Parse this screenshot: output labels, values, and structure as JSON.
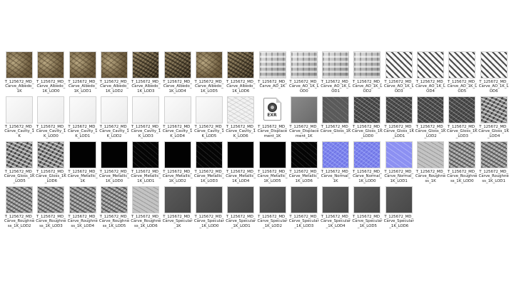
{
  "files": [
    {
      "name": "T_125672_MD_Carve_Albedo_1K",
      "style": "albedo"
    },
    {
      "name": "T_125672_MD_Carve_Albedo_1K_LOD0",
      "style": "albedo"
    },
    {
      "name": "T_125672_MD_Carve_Albedo_1K_LOD1",
      "style": "albedo"
    },
    {
      "name": "T_125672_MD_Carve_Albedo_1K_LOD2",
      "style": "albedo"
    },
    {
      "name": "T_125672_MD_Carve_Albedo_1K_LOD3",
      "style": "albedo-dark"
    },
    {
      "name": "T_125672_MD_Carve_Albedo_1K_LOD4",
      "style": "albedo-dark"
    },
    {
      "name": "T_125672_MD_Carve_Albedo_1K_LOD5",
      "style": "albedo"
    },
    {
      "name": "T_125672_MD_Carve_Albedo_1K_LOD6",
      "style": "albedo-dark"
    },
    {
      "name": "T_125672_MD_Carve_AO_1K",
      "style": "ao"
    },
    {
      "name": "T_125672_MD_Carve_AO_1K_LOD0",
      "style": "ao"
    },
    {
      "name": "T_125672_MD_Carve_AO_1K_LOD1",
      "style": "ao"
    },
    {
      "name": "T_125672_MD_Carve_AO_1K_LOD2",
      "style": "ao"
    },
    {
      "name": "T_125672_MD_Carve_AO_1K_LOD3",
      "style": "ao-strong"
    },
    {
      "name": "T_125672_MD_Carve_AO_1K_LOD4",
      "style": "ao-strong"
    },
    {
      "name": "T_125672_MD_Carve_AO_1K_LOD5",
      "style": "ao-strong"
    },
    {
      "name": "T_125672_MD_Carve_AO_1K_LOD6",
      "style": "ao-strong"
    },
    {
      "name": "T_125672_MD_Carve_Cavity_1K",
      "style": "cavity"
    },
    {
      "name": "T_125672_MD_Carve_Cavity_1K_LOD0",
      "style": "cavity"
    },
    {
      "name": "T_125672_MD_Carve_Cavity_1K_LOD1",
      "style": "cavity"
    },
    {
      "name": "T_125672_MD_Carve_Cavity_1K_LOD2",
      "style": "cavity"
    },
    {
      "name": "T_125672_MD_Carve_Cavity_1K_LOD3",
      "style": "cavity"
    },
    {
      "name": "T_125672_MD_Carve_Cavity_1K_LOD4",
      "style": "cavity"
    },
    {
      "name": "T_125672_MD_Carve_Cavity_1K_LOD5",
      "style": "cavity"
    },
    {
      "name": "T_125672_MD_Carve_Cavity_1K_LOD6",
      "style": "cavity-pattern"
    },
    {
      "name": "T_125672_MD_Carve_Displacement_1K",
      "style": "exr"
    },
    {
      "name": "T_125672_MD_Carve_Displacement_1K",
      "style": "gray-flat"
    },
    {
      "name": "T_125672_MD_Carve_Gloss_1K",
      "style": "gray-mid"
    },
    {
      "name": "T_125672_MD_Carve_Gloss_1K_LOD0",
      "style": "gloss"
    },
    {
      "name": "T_125672_MD_Carve_Gloss_1K_LOD1",
      "style": "gloss"
    },
    {
      "name": "T_125672_MD_Carve_Gloss_1K_LOD2",
      "style": "gloss"
    },
    {
      "name": "T_125672_MD_Carve_Gloss_1K_LOD3",
      "style": "gloss"
    },
    {
      "name": "T_125672_MD_Carve_Gloss_1K_LOD4",
      "style": "gloss-busy"
    },
    {
      "name": "T_125672_MD_Carve_Gloss_1K_LOD5",
      "style": "gloss-busy"
    },
    {
      "name": "T_125672_MD_Carve_Gloss_1K_LOD6",
      "style": "gloss-busy"
    },
    {
      "name": "T_125672_MD_Carve_Metallic_1K",
      "style": "black"
    },
    {
      "name": "T_125672_MD_Carve_Metallic_1K_LOD0",
      "style": "black"
    },
    {
      "name": "T_125672_MD_Carve_Metallic_1K_LOD1",
      "style": "black-pattern"
    },
    {
      "name": "T_125672_MD_Carve_Metallic_1K_LOD2",
      "style": "black"
    },
    {
      "name": "T_125672_MD_Carve_Metallic_1K_LOD3",
      "style": "black-pattern"
    },
    {
      "name": "T_125672_MD_Carve_Metallic_1K_LOD4",
      "style": "black"
    },
    {
      "name": "T_125672_MD_Carve_Metallic_1K_LOD5",
      "style": "black"
    },
    {
      "name": "T_125672_MD_Carve_Metallic_1K_LOD6",
      "style": "black-pattern"
    },
    {
      "name": "T_125672_MD_Carve_Normal_1K",
      "style": "normal"
    },
    {
      "name": "T_125672_MD_Carve_Normal_1K_LOD0",
      "style": "normal"
    },
    {
      "name": "T_125672_MD_Carve_Normal_1K_LOD1",
      "style": "normal-light"
    },
    {
      "name": "T_125672_MD_Carve_Roughness_1K",
      "style": "rough-light"
    },
    {
      "name": "T_125672_MD_Carve_Roughness_1K_LOD0",
      "style": "rough"
    },
    {
      "name": "T_125672_MD_Carve_Roughness_1K_LOD1",
      "style": "rough"
    },
    {
      "name": "T_125672_MD_Carve_Roughness_1K_LOD2",
      "style": "rough"
    },
    {
      "name": "T_125672_MD_Carve_Roughness_1K_LOD3",
      "style": "rough"
    },
    {
      "name": "T_125672_MD_Carve_Roughness_1K_LOD4",
      "style": "rough"
    },
    {
      "name": "T_125672_MD_Carve_Roughness_1K_LOD5",
      "style": "rough"
    },
    {
      "name": "T_125672_MD_Carve_Roughness_1K_LOD6",
      "style": "rough-light"
    },
    {
      "name": "T_125672_MD_Carve_Specular_1K",
      "style": "spec"
    },
    {
      "name": "T_125672_MD_Carve_Specular_1K_LOD0",
      "style": "spec"
    },
    {
      "name": "T_125672_MD_Carve_Specular_1K_LOD1",
      "style": "spec"
    },
    {
      "name": "T_125672_MD_Carve_Specular_1K_LOD2",
      "style": "spec"
    },
    {
      "name": "T_125672_MD_Carve_Specular_1K_LOD3",
      "style": "spec"
    },
    {
      "name": "T_125672_MD_Carve_Specular_1K_LOD4",
      "style": "spec"
    },
    {
      "name": "T_125672_MD_Carve_Specular_1K_LOD5",
      "style": "spec"
    },
    {
      "name": "T_125672_MD_Carve_Specular_1K_LOD6",
      "style": "spec"
    }
  ],
  "exr_icon": {
    "label": "EXR"
  }
}
